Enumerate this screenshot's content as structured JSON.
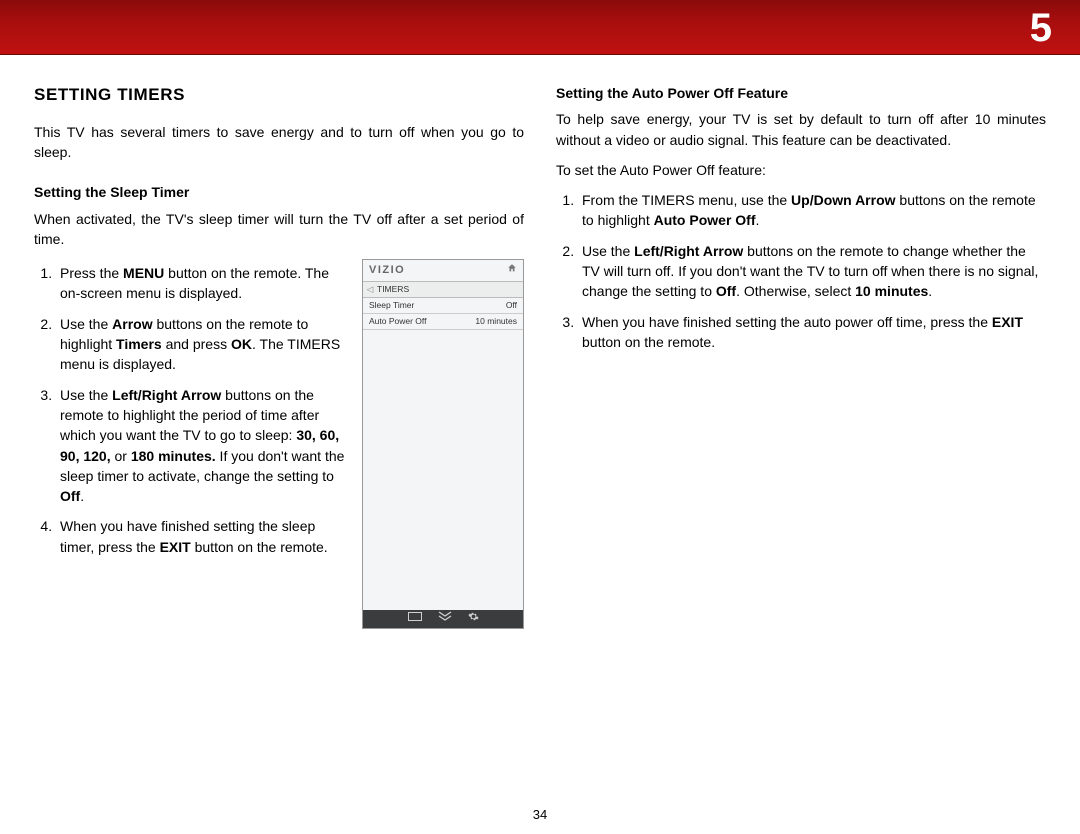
{
  "chapter_number": "5",
  "page_number": "34",
  "left": {
    "heading": "SETTING TIMERS",
    "intro": "This TV has several timers to save energy and to turn off when you go to sleep.",
    "sub1_title": "Setting the Sleep Timer",
    "sub1_intro": "When activated, the TV's sleep timer will turn the TV off after a set period of time.",
    "step1_a": "Press the ",
    "step1_b": "MENU",
    "step1_c": " button on the remote. The on-screen menu is displayed.",
    "step2_a": "Use the ",
    "step2_b": "Arrow",
    "step2_c": " buttons on the remote to highlight ",
    "step2_d": "Timers",
    "step2_e": " and press ",
    "step2_f": "OK",
    "step2_g": ". The TIMERS menu is displayed.",
    "step3_a": "Use the ",
    "step3_b": "Left/Right Arrow",
    "step3_c": " buttons on the remote to highlight the period of time after which you want the TV to go to sleep: ",
    "step3_d": "30, 60, 90, 120,",
    "step3_e": " or ",
    "step3_f": "180 minutes.",
    "step3_g": " If you don't want the sleep timer to activate, change the setting to ",
    "step3_h": "Off",
    "step3_i": ".",
    "step4_a": "When you have finished setting the sleep timer, press the ",
    "step4_b": "EXIT",
    "step4_c": " button on the remote."
  },
  "screenshot": {
    "logo": "VIZIO",
    "breadcrumb": "TIMERS",
    "row1_label": "Sleep Timer",
    "row1_value": "Off",
    "row2_label": "Auto Power Off",
    "row2_value": "10 minutes"
  },
  "right": {
    "sub_title": "Setting the Auto Power Off Feature",
    "intro": "To help save energy, your TV is set by default to turn off after 10 minutes without a video or audio signal. This feature can be deactivated.",
    "lead": "To set the Auto Power Off feature:",
    "step1_a": "From the TIMERS menu, use the ",
    "step1_b": "Up/Down Arrow",
    "step1_c": " buttons on the remote to highlight ",
    "step1_d": "Auto Power Off",
    "step1_e": ".",
    "step2_a": "Use the ",
    "step2_b": "Left/Right Arrow",
    "step2_c": " buttons on the remote to change whether the TV will turn off. If you don't want the TV to turn off when there is no signal, change the setting to ",
    "step2_d": "Off",
    "step2_e": ". Otherwise, select ",
    "step2_f": "10 minutes",
    "step2_g": ".",
    "step3_a": "When you have finished setting the auto power off time, press the ",
    "step3_b": "EXIT",
    "step3_c": " button on the remote."
  }
}
